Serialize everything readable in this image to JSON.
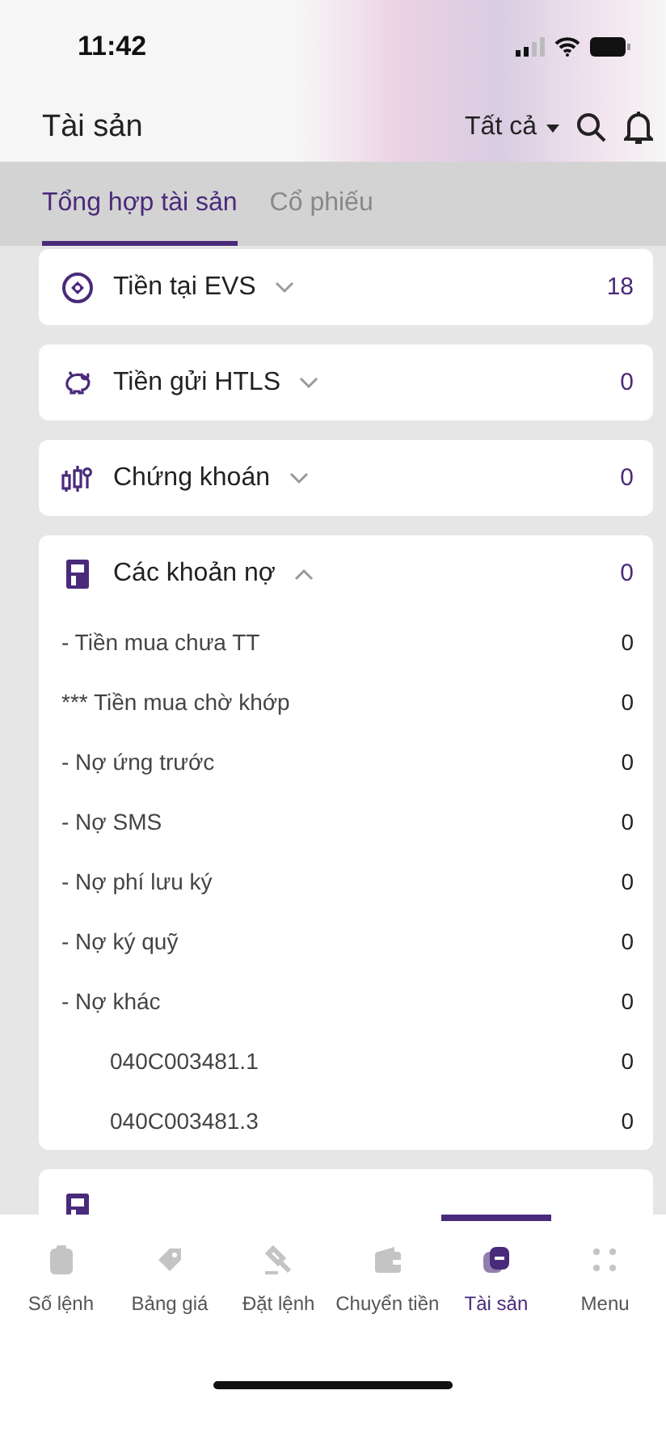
{
  "status_bar": {
    "time": "11:42"
  },
  "header": {
    "title": "Tài sản",
    "filter": "Tất cả"
  },
  "tabs": [
    {
      "label": "Tổng hợp tài sản",
      "selected": true
    },
    {
      "label": "Cổ phiếu",
      "selected": false
    }
  ],
  "groups": [
    {
      "label": "Tiền tại EVS",
      "value": "18",
      "expanded": false
    },
    {
      "label": "Tiền gửi HTLS",
      "value": "0",
      "expanded": false
    },
    {
      "label": "Chứng khoán",
      "value": "0",
      "expanded": false
    },
    {
      "label": "Các khoản nợ",
      "value": "0",
      "expanded": true,
      "rows": [
        {
          "label": "- Tiền mua chưa TT",
          "value": "0"
        },
        {
          "label": "*** Tiền mua chờ khớp",
          "value": "0"
        },
        {
          "label": "- Nợ ứng trước",
          "value": "0"
        },
        {
          "label": "- Nợ SMS",
          "value": "0"
        },
        {
          "label": "- Nợ phí lưu ký",
          "value": "0"
        },
        {
          "label": "- Nợ ký quỹ",
          "value": "0"
        },
        {
          "label": "- Nợ khác",
          "value": "0",
          "children": [
            {
              "label": "040C003481.1",
              "value": "0"
            },
            {
              "label": "040C003481.3",
              "value": "0"
            }
          ]
        }
      ]
    }
  ],
  "bottom_nav": [
    {
      "label": "Số lệnh",
      "selected": false
    },
    {
      "label": "Bảng giá",
      "selected": false
    },
    {
      "label": "Đặt lệnh",
      "selected": false
    },
    {
      "label": "Chuyển tiền",
      "selected": false
    },
    {
      "label": "Tài sản",
      "selected": true
    },
    {
      "label": "Menu",
      "selected": false
    }
  ]
}
